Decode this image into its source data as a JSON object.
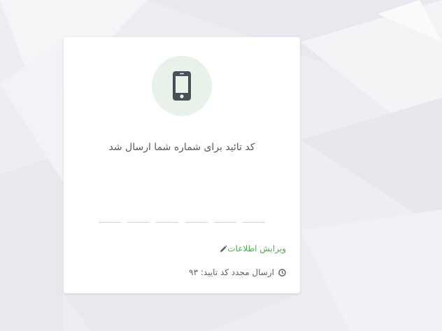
{
  "card": {
    "title": "کد تائید برای شماره شما ارسال شد",
    "edit_link": "ویرایش اطلاعات",
    "resend_text": "ارسال مجدد کد تایید: ۹۳"
  },
  "otp": {
    "digit_count": 6,
    "values": [
      "",
      "",
      "",
      "",
      "",
      ""
    ]
  },
  "icons": {
    "phone": "mobile-phone-icon",
    "edit": "pencil-icon",
    "timer": "clock-icon"
  },
  "colors": {
    "accent_green": "#4caf50",
    "icon_circle_bg": "#e9f2ea",
    "phone_icon": "#4a4f57"
  }
}
